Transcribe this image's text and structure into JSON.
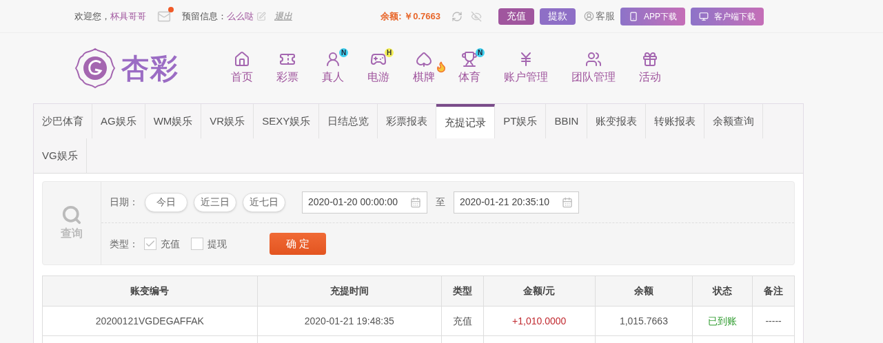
{
  "top_bar": {
    "welcome_label": "欢迎您，",
    "username": "杯具哥哥",
    "mail_unread": true,
    "reserved_label": "预留信息：",
    "reserved_value": "么么哒",
    "logout": "退出",
    "balance": "余额: ￥0.7663",
    "deposit": "充值",
    "withdraw": "提款",
    "service": "客服",
    "app_download": "APP下载",
    "client_download": "客户端下载"
  },
  "logo": {
    "text": "杏彩"
  },
  "nav": [
    {
      "kind": "home",
      "label": "首页",
      "hot": false
    },
    {
      "kind": "ticket",
      "label": "彩票",
      "hot": false
    },
    {
      "kind": "live",
      "label": "真人",
      "badge": "N",
      "hot": false
    },
    {
      "kind": "game",
      "label": "电游",
      "badge": "H",
      "hot": false
    },
    {
      "kind": "cards",
      "label": "棋牌",
      "hot": true
    },
    {
      "kind": "sports",
      "label": "体育",
      "badge": "N",
      "hot": false
    },
    {
      "kind": "account",
      "label": "账户管理",
      "hot": false
    },
    {
      "kind": "team",
      "label": "团队管理",
      "hot": false
    },
    {
      "kind": "gift",
      "label": "活动",
      "hot": false
    }
  ],
  "tabs": [
    {
      "label": "沙巴体育",
      "selected": false
    },
    {
      "label": "AG娱乐",
      "selected": false
    },
    {
      "label": "WM娱乐",
      "selected": false
    },
    {
      "label": "VR娱乐",
      "selected": false
    },
    {
      "label": "SEXY娱乐",
      "selected": false
    },
    {
      "label": "日结总览",
      "selected": false
    },
    {
      "label": "彩票报表",
      "selected": false
    },
    {
      "label": "充提记录",
      "selected": true
    },
    {
      "label": "PT娱乐",
      "selected": false
    },
    {
      "label": "BBIN",
      "selected": false
    },
    {
      "label": "账变报表",
      "selected": false
    },
    {
      "label": "转账报表",
      "selected": false
    },
    {
      "label": "余额查询",
      "selected": false
    },
    {
      "label": "VG娱乐",
      "selected": false
    }
  ],
  "query": {
    "label": "查询",
    "date_label": "日期：",
    "ranges": [
      "今日",
      "近三日",
      "近七日"
    ],
    "from": "2020-01-20 00:00:00",
    "to_label": "至",
    "to": "2020-01-21 20:35:10",
    "type_label": "类型：",
    "types": [
      {
        "label": "充值",
        "checked": true
      },
      {
        "label": "提现",
        "checked": false
      }
    ],
    "confirm": "确 定"
  },
  "table": {
    "columns": [
      "账变编号",
      "充提时间",
      "类型",
      "金额/元",
      "余额",
      "状态",
      "备注"
    ],
    "rows": [
      {
        "cells": [
          "20200121VGDEGAFFAK",
          "2020-01-21 19:48:35",
          "充值",
          "+1,010.0000",
          "1,015.7663",
          "已到账",
          "-----"
        ]
      }
    ]
  }
}
